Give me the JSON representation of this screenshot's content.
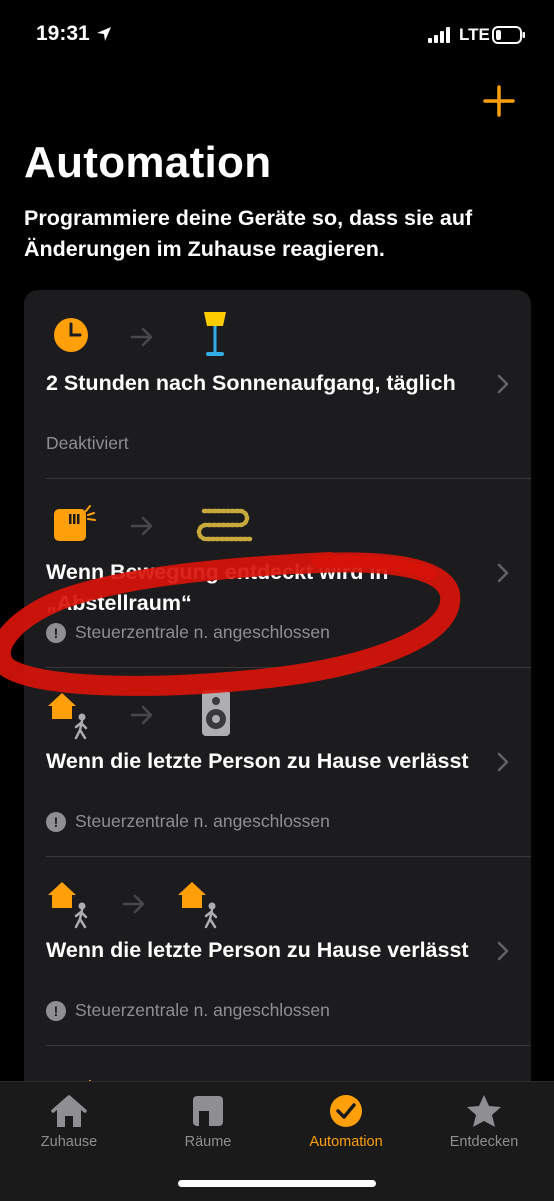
{
  "status_bar": {
    "time": "19:31",
    "network": "LTE"
  },
  "header": {
    "title": "Automation",
    "subtitle": "Programmiere deine Geräte so, dass sie auf Änderungen im Zuhause reagieren."
  },
  "automations": [
    {
      "title": "2 Stunden nach Sonnenaufgang, täglich",
      "status": "Deaktiviert",
      "trigger_icon": "clock-icon",
      "action_icon": "floor-lamp-icon"
    },
    {
      "title": "Wenn Bewegung entdeckt wird in „Abstellraum“",
      "status": "Steuerzentrale n. angeschlossen",
      "trigger_icon": "motion-sensor-icon",
      "action_icon": "light-strip-icon"
    },
    {
      "title": "Wenn die letzte Person zu Hause verlässt",
      "status": "Steuerzentrale n. angeschlossen",
      "trigger_icon": "person-leaving-home-icon",
      "action_icon": "speaker-icon"
    },
    {
      "title": "Wenn die letzte Person zu Hause verlässt",
      "status": "Steuerzentrale n. angeschlossen",
      "trigger_icon": "person-leaving-home-icon",
      "action_icon": "person-leaving-home-icon"
    }
  ],
  "tabs": [
    {
      "label": "Zuhause",
      "icon": "house-icon",
      "active": false
    },
    {
      "label": "Räume",
      "icon": "rooms-icon",
      "active": false
    },
    {
      "label": "Automation",
      "icon": "automation-clock-icon",
      "active": true
    },
    {
      "label": "Entdecken",
      "icon": "star-icon",
      "active": false
    }
  ],
  "colors": {
    "accent": "#ff9f0a",
    "card": "#1c1c1e",
    "secondary_text": "#8e8e93",
    "annotation": "#e01b0b"
  }
}
